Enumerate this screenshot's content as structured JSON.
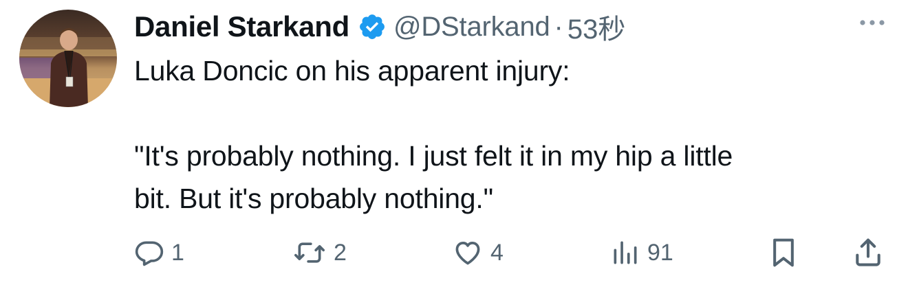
{
  "tweet": {
    "display_name": "Daniel Starkand",
    "handle": "@DStarkand",
    "separator": "·",
    "time": "53秒",
    "text_line_1": "Luka Doncic on his apparent injury:",
    "text_line_2": "\"It's probably nothing. I just felt it in my hip a little",
    "text_line_3": "bit. But it's probably nothing.\"",
    "verified": true,
    "colors": {
      "verified_blue": "#1d9bf0",
      "secondary_text": "#536471",
      "primary_text": "#0f1419"
    }
  },
  "actions": {
    "reply_count": "1",
    "retweet_count": "2",
    "like_count": "4",
    "views_count": "91"
  },
  "icons": {
    "verified": "verified-badge-icon",
    "more": "more-options-icon",
    "reply": "reply-icon",
    "retweet": "retweet-icon",
    "like": "heart-icon",
    "views": "views-bar-chart-icon",
    "bookmark": "bookmark-icon",
    "share": "share-icon"
  }
}
